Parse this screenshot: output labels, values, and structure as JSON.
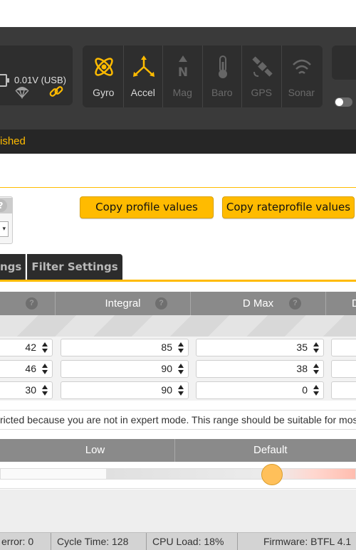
{
  "header": {
    "battery_text": "0.01V (USB)",
    "sensors": [
      {
        "label": "Gyro",
        "state": "on",
        "icon": "gyro-icon"
      },
      {
        "label": "Accel",
        "state": "on",
        "icon": "accel-icon"
      },
      {
        "label": "Mag",
        "state": "off",
        "icon": "mag-icon"
      },
      {
        "label": "Baro",
        "state": "off",
        "icon": "baro-icon"
      },
      {
        "label": "GPS",
        "state": "off",
        "icon": "gps-icon"
      },
      {
        "label": "Sonar",
        "state": "off",
        "icon": "sonar-icon"
      }
    ],
    "status_text": "ished",
    "accent": "#ffbb00"
  },
  "profile": {
    "help": "?",
    "copy_profile_label": "Copy profile values",
    "copy_rateprofile_label": "Copy rateprofile values"
  },
  "tabs": [
    {
      "label": "ngs"
    },
    {
      "label": "Filter Settings"
    }
  ],
  "pid_table": {
    "headers": [
      "Integral",
      "D Max",
      "D"
    ],
    "help": "?",
    "rows": [
      {
        "p": "42",
        "i": "85",
        "d": "35"
      },
      {
        "p": "46",
        "i": "90",
        "d": "38"
      },
      {
        "p": "30",
        "i": "90",
        "d": "0"
      }
    ]
  },
  "notice": "ricted because you are not in expert mode. This range should be suitable for most builds.",
  "slider": {
    "labels": [
      "Low",
      "Default"
    ],
    "level_fraction": 0.765
  },
  "footer": {
    "items": [
      "error: 0",
      "Cycle Time: 128",
      "CPU Load: 18%",
      "Firmware: BTFL 4.1"
    ]
  }
}
